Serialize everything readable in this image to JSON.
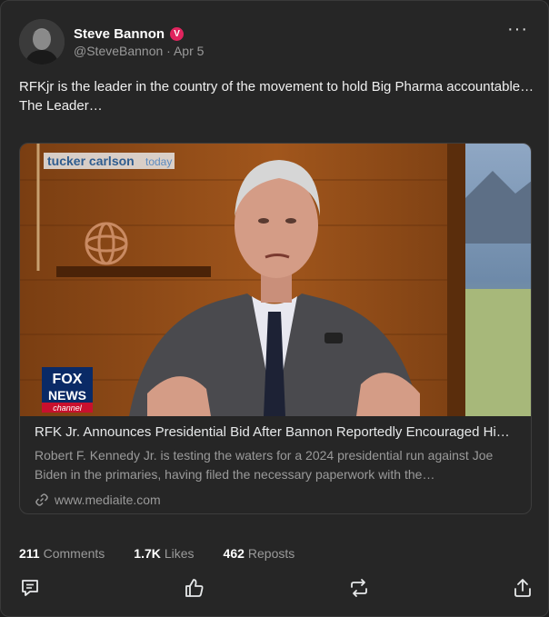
{
  "author": {
    "name": "Steve Bannon",
    "verified_badge": "V",
    "handle": "@SteveBannon",
    "separator": "·",
    "date": "Apr 5"
  },
  "menu": {
    "more_label": "···"
  },
  "post": {
    "line1": "RFKjr is the leader in the country of the movement to hold Big Pharma accountable…",
    "line2": "The Leader…"
  },
  "link_card": {
    "image_overlay": {
      "show_name": "tucker carlson",
      "show_tag": "today",
      "network_logo": {
        "line1": "FOX",
        "line2": "NEWS",
        "line3": "channel"
      }
    },
    "title": "RFK Jr. Announces Presidential Bid After Bannon Reportedly Encouraged Him…",
    "description": "Robert F. Kennedy Jr. is testing the waters for a 2024 presidential run against Joe Biden in the primaries, having filed the necessary paperwork with the…",
    "domain": "www.mediaite.com"
  },
  "stats": {
    "comments_count": "211",
    "comments_label": "Comments",
    "likes_count": "1.7K",
    "likes_label": "Likes",
    "reposts_count": "462",
    "reposts_label": "Reposts"
  },
  "colors": {
    "background": "#262626",
    "verified": "#e0245e",
    "text_muted": "#9a9a9a"
  }
}
